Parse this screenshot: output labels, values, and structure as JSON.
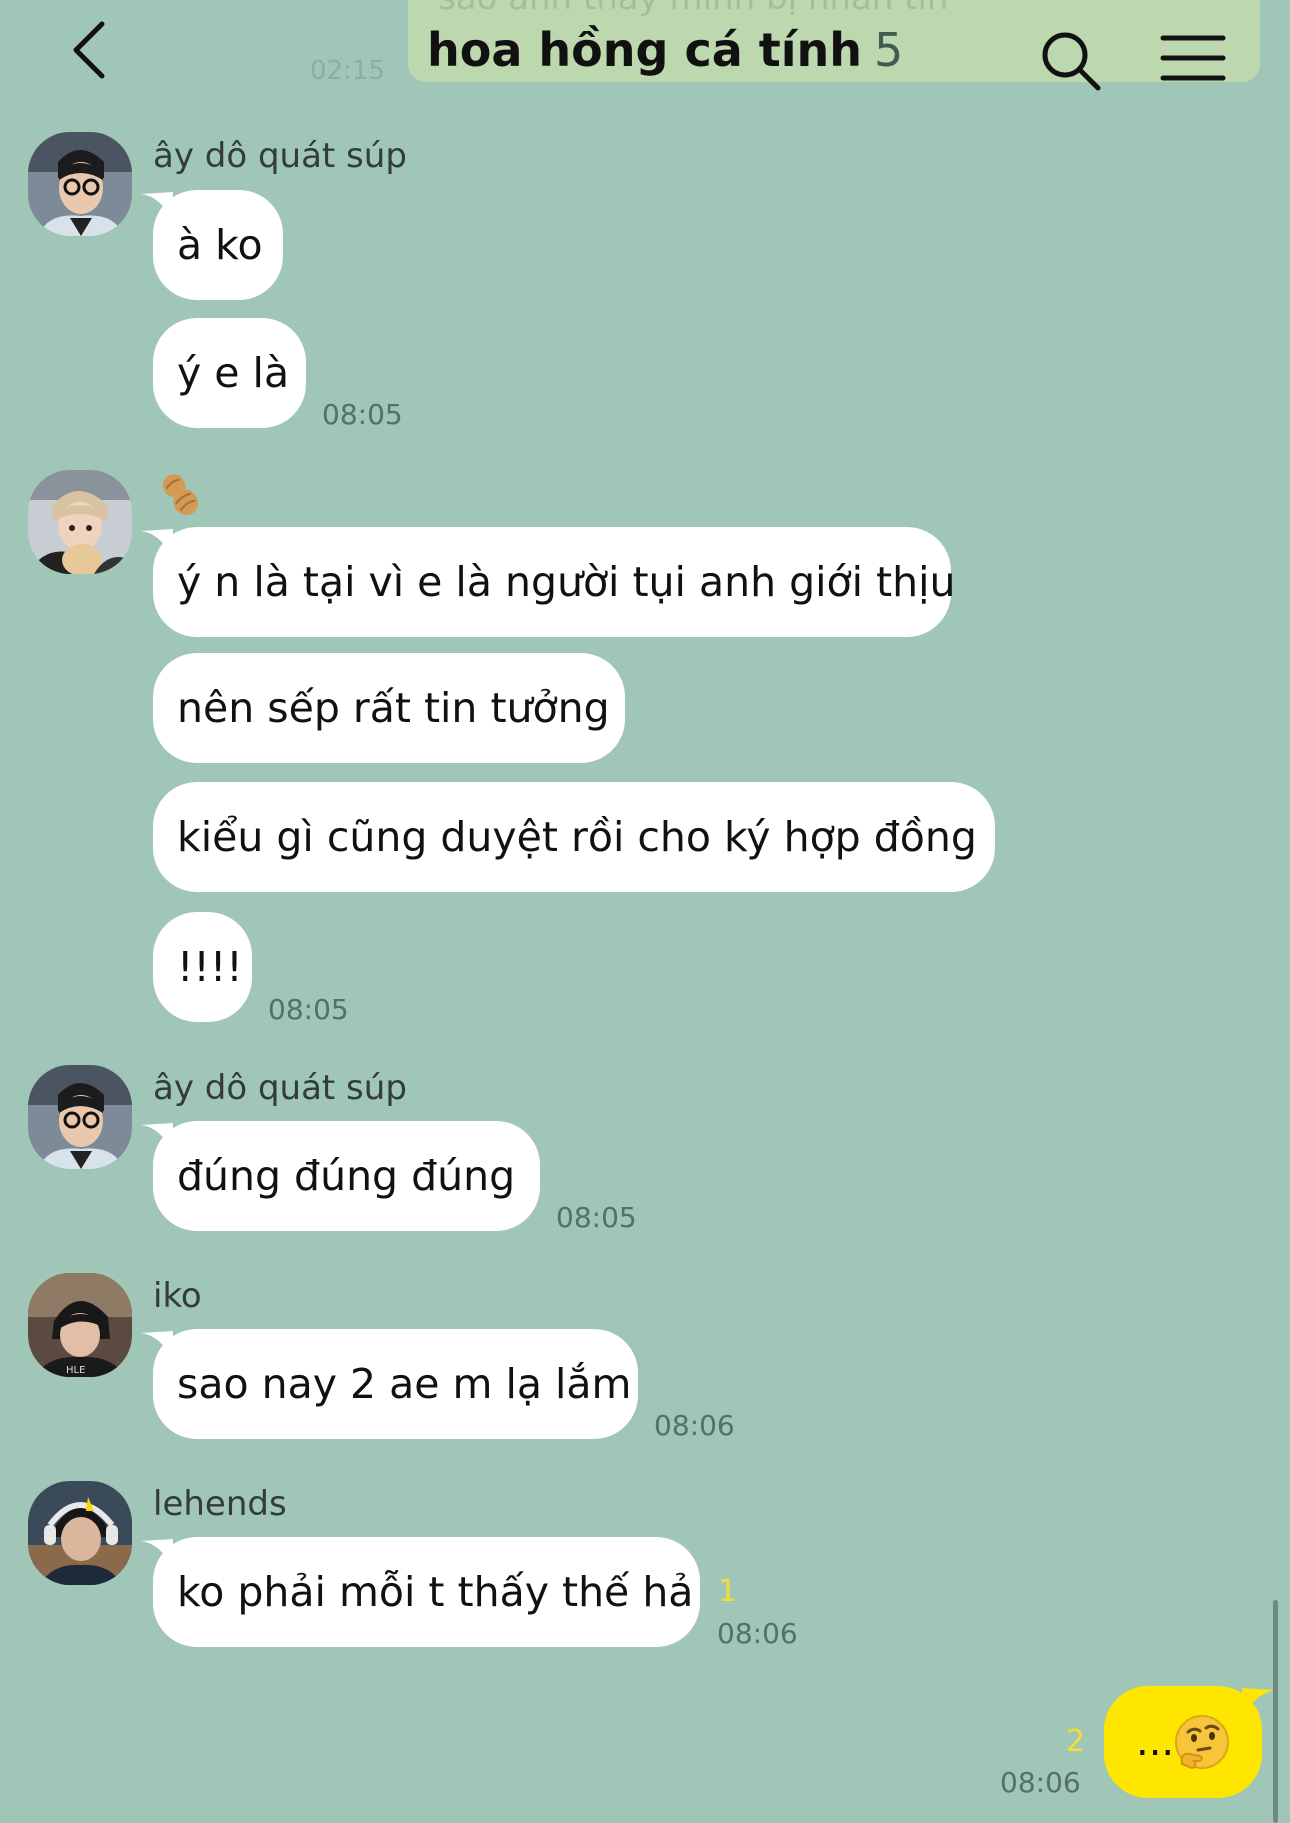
{
  "header": {
    "title": "hoa hồng cá tính",
    "member_count": "5",
    "back_icon": "chevron-left-icon",
    "search_icon": "search-icon",
    "menu_icon": "hamburger-menu-icon"
  },
  "previous_message": {
    "text": "sao anh thấy mình bị nhắn tin",
    "time": "02:15"
  },
  "messages": [
    {
      "sender": "ây dô quát súp",
      "bubbles": [
        "à ko",
        "ý e là"
      ],
      "time": "08:05"
    },
    {
      "sender": "🥜",
      "bubbles": [
        "ý n là tại vì e là người tụi anh giới thịu",
        "nên sếp rất tin tưởng",
        "kiểu gì cũng duyệt rồi cho ký hợp đồng",
        "!!!!"
      ],
      "time": "08:05"
    },
    {
      "sender": "ây dô quát súp",
      "bubbles": [
        "đúng đúng đúng"
      ],
      "time": "08:05"
    },
    {
      "sender": "iko",
      "bubbles": [
        "sao nay 2 ae m lạ lắm"
      ],
      "time": "08:06"
    },
    {
      "sender": "lehends",
      "bubbles": [
        "ko phải mỗi t thấy thế hả"
      ],
      "unread": "1",
      "time": "08:06"
    }
  ],
  "my_message": {
    "text": "...",
    "emoji_icon": "thinking-face-icon",
    "unread": "2",
    "time": "08:06"
  },
  "colors": {
    "background": "#9fc6b6",
    "my_bubble": "#ffe600",
    "their_bubble": "#ffffff",
    "unread": "#f2de3a"
  }
}
